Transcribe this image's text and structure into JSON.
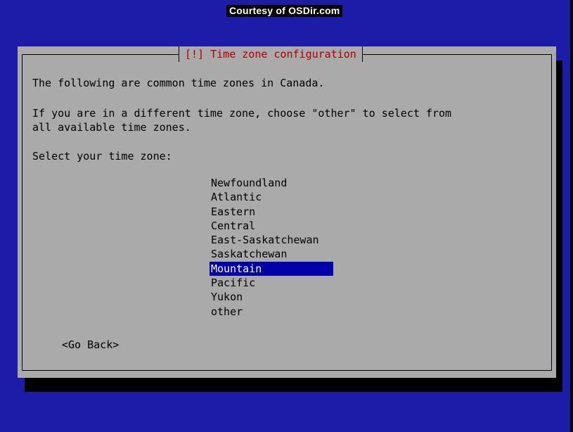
{
  "watermark": "Courtesy of OSDir.com",
  "dialog": {
    "title": "[!] Time zone configuration",
    "intro": "The following are common time zones in Canada.",
    "instruction_line1": "If you are in a different time zone, choose \"other\" to select from",
    "instruction_line2": "all available time zones.",
    "prompt": "Select your time zone:",
    "options": [
      "Newfoundland",
      "Atlantic",
      "Eastern",
      "Central",
      "East-Saskatchewan",
      "Saskatchewan",
      "Mountain",
      "Pacific",
      "Yukon",
      "other"
    ],
    "selected_option": "Mountain",
    "back_button": "<Go Back>"
  },
  "colors": {
    "background": "#1c1ca8",
    "dialog": "#aaaaaa",
    "title_text": "#aa0000",
    "highlight": "#0000aa",
    "highlight_text": "#ffffff"
  }
}
